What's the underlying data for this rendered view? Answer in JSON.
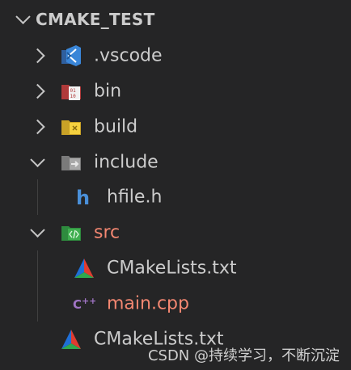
{
  "explorer": {
    "root_label": "CMAKE_TEST",
    "items": [
      {
        "label": ".vscode"
      },
      {
        "label": "bin"
      },
      {
        "label": "build"
      },
      {
        "label": "include"
      },
      {
        "label": "hfile.h"
      },
      {
        "label": "src"
      },
      {
        "label": "CMakeLists.txt"
      },
      {
        "label": "main.cpp"
      },
      {
        "label": "CMakeLists.txt"
      }
    ]
  },
  "watermark": "CSDN @持续学习，不断沉淀",
  "colors": {
    "background": "#252526",
    "text": "#cccccc",
    "modified": "#f48771",
    "vscode_blue": "#3a86d8",
    "h_file": "#4a90d9",
    "cpp": "#a074c4"
  },
  "icons": {
    "root": "chevron-down-icon",
    "vscode": "vscode-folder-icon",
    "bin": "binary-folder-icon",
    "build": "build-folder-icon",
    "include": "include-folder-icon",
    "hfile": "h-file-icon",
    "src": "src-folder-icon",
    "cmake": "cmake-icon",
    "cpp": "cpp-file-icon"
  }
}
